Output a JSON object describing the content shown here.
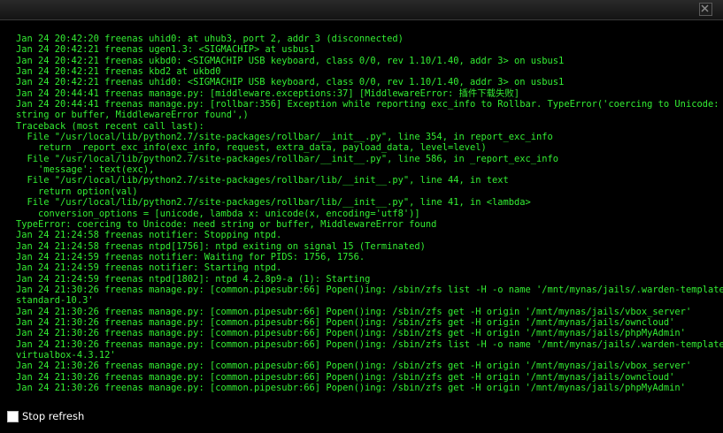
{
  "window": {
    "close_icon": "close-icon"
  },
  "colors": {
    "console_text": "#33ee33",
    "background": "#000000",
    "footer_text": "#ffffff"
  },
  "console": {
    "lines": [
      "Jan 24 20:42:20 freenas uhid0: at uhub3, port 2, addr 3 (disconnected)",
      "Jan 24 20:42:21 freenas ugen1.3: <SIGMACHIP> at usbus1",
      "Jan 24 20:42:21 freenas ukbd0: <SIGMACHIP USB keyboard, class 0/0, rev 1.10/1.40, addr 3> on usbus1",
      "Jan 24 20:42:21 freenas kbd2 at ukbd0",
      "Jan 24 20:42:21 freenas uhid0: <SIGMACHIP USB keyboard, class 0/0, rev 1.10/1.40, addr 3> on usbus1",
      "Jan 24 20:44:41 freenas manage.py: [middleware.exceptions:37] [MiddlewareError: 插件下载失败]",
      "Jan 24 20:44:41 freenas manage.py: [rollbar:356] Exception while reporting exc_info to Rollbar. TypeError('coercing to Unicode: need",
      "string or buffer, MiddlewareError found',)",
      "Traceback (most recent call last):",
      "  File \"/usr/local/lib/python2.7/site-packages/rollbar/__init__.py\", line 354, in report_exc_info",
      "    return _report_exc_info(exc_info, request, extra_data, payload_data, level=level)",
      "  File \"/usr/local/lib/python2.7/site-packages/rollbar/__init__.py\", line 586, in _report_exc_info",
      "    'message': text(exc),",
      "  File \"/usr/local/lib/python2.7/site-packages/rollbar/lib/__init__.py\", line 44, in text",
      "    return option(val)",
      "  File \"/usr/local/lib/python2.7/site-packages/rollbar/lib/__init__.py\", line 41, in <lambda>",
      "    conversion_options = [unicode, lambda x: unicode(x, encoding='utf8')]",
      "TypeError: coercing to Unicode: need string or buffer, MiddlewareError found",
      "Jan 24 21:24:58 freenas notifier: Stopping ntpd.",
      "Jan 24 21:24:58 freenas ntpd[1756]: ntpd exiting on signal 15 (Terminated)",
      "Jan 24 21:24:59 freenas notifier: Waiting for PIDS: 1756, 1756.",
      "Jan 24 21:24:59 freenas notifier: Starting ntpd.",
      "Jan 24 21:24:59 freenas ntpd[1802]: ntpd 4.2.8p9-a (1): Starting",
      "Jan 24 21:30:26 freenas manage.py: [common.pipesubr:66] Popen()ing: /sbin/zfs list -H -o name '/mnt/mynas/jails/.warden-template-",
      "standard-10.3'",
      "Jan 24 21:30:26 freenas manage.py: [common.pipesubr:66] Popen()ing: /sbin/zfs get -H origin '/mnt/mynas/jails/vbox_server'",
      "Jan 24 21:30:26 freenas manage.py: [common.pipesubr:66] Popen()ing: /sbin/zfs get -H origin '/mnt/mynas/jails/owncloud'",
      "Jan 24 21:30:26 freenas manage.py: [common.pipesubr:66] Popen()ing: /sbin/zfs get -H origin '/mnt/mynas/jails/phpMyAdmin'",
      "Jan 24 21:30:26 freenas manage.py: [common.pipesubr:66] Popen()ing: /sbin/zfs list -H -o name '/mnt/mynas/jails/.warden-template-",
      "virtualbox-4.3.12'",
      "Jan 24 21:30:26 freenas manage.py: [common.pipesubr:66] Popen()ing: /sbin/zfs get -H origin '/mnt/mynas/jails/vbox_server'",
      "Jan 24 21:30:26 freenas manage.py: [common.pipesubr:66] Popen()ing: /sbin/zfs get -H origin '/mnt/mynas/jails/owncloud'",
      "Jan 24 21:30:26 freenas manage.py: [common.pipesubr:66] Popen()ing: /sbin/zfs get -H origin '/mnt/mynas/jails/phpMyAdmin'"
    ]
  },
  "footer": {
    "stop_refresh_label": "Stop refresh",
    "stop_refresh_checked": false
  }
}
